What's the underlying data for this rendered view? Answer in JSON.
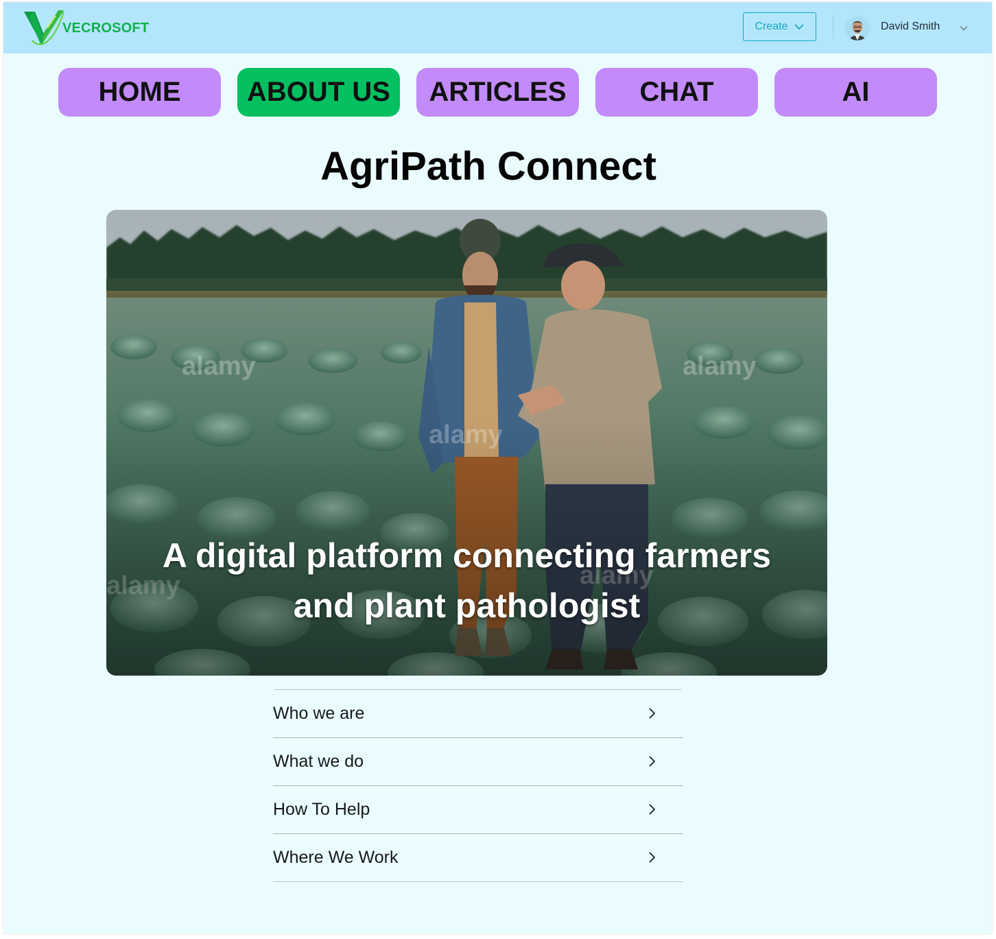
{
  "header": {
    "brand": "VECROSOFT",
    "logo_icon": "vecrosoft-v-logo",
    "create_label": "Create",
    "user_name": "David Smith",
    "colors": {
      "bar": "#b3e6fd",
      "brand": "#10b04a",
      "create": "#14a7c0"
    }
  },
  "nav": {
    "items": [
      {
        "label": "HOME",
        "active": false
      },
      {
        "label": "ABOUT US",
        "active": true
      },
      {
        "label": "ARTICLES",
        "active": false
      },
      {
        "label": "CHAT",
        "active": false
      },
      {
        "label": "AI",
        "active": false
      }
    ],
    "colors": {
      "default": "#c28bf9",
      "active": "#04c061"
    }
  },
  "main": {
    "title": "AgriPath Connect",
    "hero": {
      "image": "two farmers walking through a cabbage field",
      "caption_line1": "A digital platform connecting farmers",
      "caption_line2": "and plant pathologist",
      "watermark": "alamy"
    },
    "accordion": [
      {
        "label": "Who we are",
        "icon": "chevron-right-icon"
      },
      {
        "label": "What we do",
        "icon": "chevron-right-icon"
      },
      {
        "label": "How To Help",
        "icon": "chevron-right-icon"
      },
      {
        "label": "Where We Work",
        "icon": "chevron-right-icon"
      }
    ]
  }
}
